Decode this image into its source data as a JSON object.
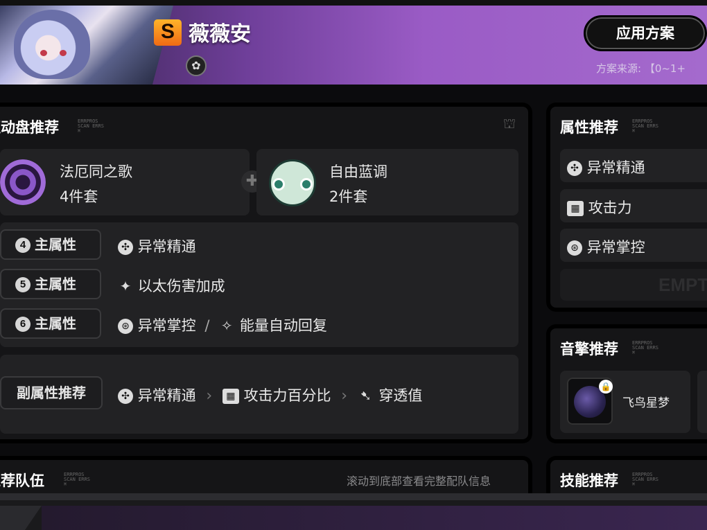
{
  "header": {
    "rank": "S",
    "character_name": "薇薇安",
    "apply_button": "应用方案",
    "source_label": "方案来源: 【0~1+"
  },
  "drive_disc": {
    "title": "驱动盘推荐",
    "sets": [
      {
        "name": "法厄同之歌",
        "count": "4件套"
      },
      {
        "name": "自由蓝调",
        "count": "2件套"
      }
    ],
    "main_stats": [
      {
        "slot": "4",
        "label": "主属性",
        "value": "异常精通"
      },
      {
        "slot": "5",
        "label": "主属性",
        "value": "以太伤害加成"
      },
      {
        "slot": "6",
        "label": "主属性",
        "value": "异常掌控",
        "separator": "/",
        "value2": "能量自动回复"
      }
    ],
    "sub_stats": {
      "label": "副属性推荐",
      "values": [
        "异常精通",
        "攻击力百分比",
        "穿透值"
      ]
    }
  },
  "attributes": {
    "title": "属性推荐",
    "items": [
      "异常精通",
      "攻击力",
      "异常掌控"
    ],
    "empty_label": "EMPTY"
  },
  "wengine": {
    "title": "音擎推荐",
    "items": [
      {
        "name": "飞鸟星梦"
      }
    ]
  },
  "team": {
    "title": "推荐队伍",
    "hint": "滚动到底部查看完整配队信息"
  },
  "skills": {
    "title": "技能推荐"
  },
  "deco_text": "ERRPROS\nSCAN ERRS\n⌘",
  "colors": {
    "header_accent": "#9a5bc5",
    "rank_gradient_top": "#ffb42a",
    "panel_bg": "#151517",
    "card_bg": "#222224"
  }
}
